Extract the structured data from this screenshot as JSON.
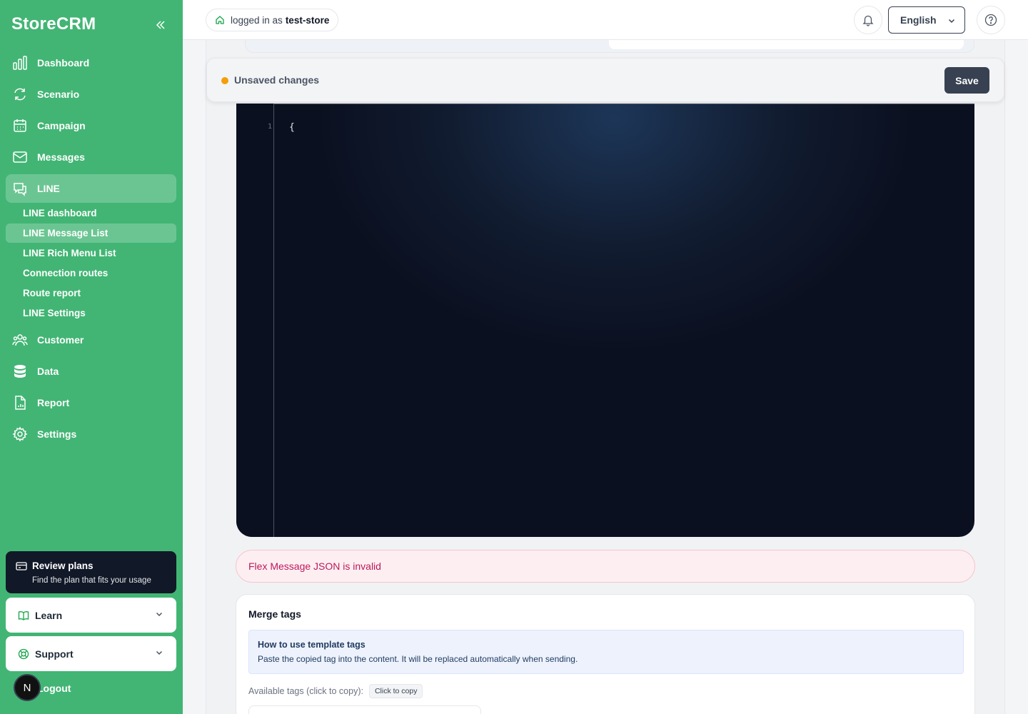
{
  "brand": "StoreCRM",
  "sidebar": {
    "items": [
      {
        "label": "Dashboard",
        "icon": "bar-chart-icon"
      },
      {
        "label": "Scenario",
        "icon": "refresh-icon"
      },
      {
        "label": "Campaign",
        "icon": "calendar-icon"
      },
      {
        "label": "Messages",
        "icon": "mail-icon"
      },
      {
        "label": "LINE",
        "icon": "chat-icon"
      },
      {
        "label": "Customer",
        "icon": "users-icon"
      },
      {
        "label": "Data",
        "icon": "database-icon"
      },
      {
        "label": "Report",
        "icon": "document-chart-icon"
      },
      {
        "label": "Settings",
        "icon": "gear-icon"
      }
    ],
    "line_sub": [
      {
        "label": "LINE dashboard"
      },
      {
        "label": "LINE Message List"
      },
      {
        "label": "LINE Rich Menu List"
      },
      {
        "label": "Connection routes"
      },
      {
        "label": "Route report"
      },
      {
        "label": "LINE Settings"
      }
    ],
    "plan_card": {
      "title": "Review plans",
      "subtitle": "Find the plan that fits your usage"
    },
    "learn": "Learn",
    "support": "Support",
    "logout": "Logout",
    "avatar_initial": "N"
  },
  "header": {
    "logged_prefix": "logged in as",
    "store_name": "test-store",
    "language": "English"
  },
  "unsaved": {
    "label": "Unsaved changes",
    "save": "Save"
  },
  "editor": {
    "line_number": "1",
    "code": "{"
  },
  "error": "Flex Message JSON is invalid",
  "merge": {
    "title": "Merge tags",
    "info_title": "How to use template tags",
    "info_text": "Paste the copied tag into the content. It will be replaced automatically when sending.",
    "available_label": "Available tags (click to copy):",
    "copy_chip": "Click to copy"
  },
  "colors": {
    "sidebar": "#42b574",
    "accent_dark": "#374151",
    "warning": "#f59e0b",
    "error_text": "#be185d"
  }
}
